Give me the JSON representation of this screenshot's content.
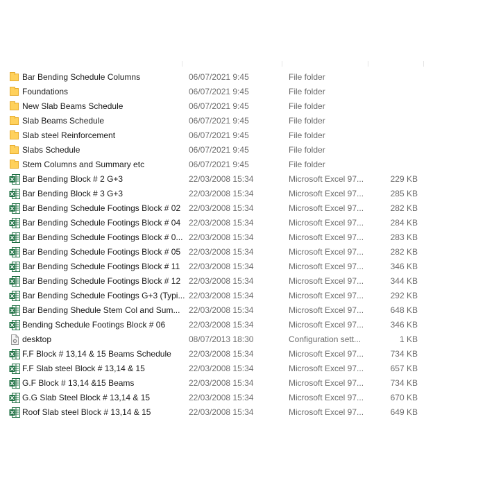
{
  "files": [
    {
      "name": "Bar Bending Schedule Columns",
      "date": "06/07/2021 9:45",
      "type": "File folder",
      "size": "",
      "icon": "folder-icon"
    },
    {
      "name": "Foundations",
      "date": "06/07/2021 9:45",
      "type": "File folder",
      "size": "",
      "icon": "folder-icon"
    },
    {
      "name": "New Slab Beams Schedule",
      "date": "06/07/2021 9:45",
      "type": "File folder",
      "size": "",
      "icon": "folder-icon"
    },
    {
      "name": "Slab Beams Schedule",
      "date": "06/07/2021 9:45",
      "type": "File folder",
      "size": "",
      "icon": "folder-icon"
    },
    {
      "name": "Slab steel Reinforcement",
      "date": "06/07/2021 9:45",
      "type": "File folder",
      "size": "",
      "icon": "folder-icon"
    },
    {
      "name": "Slabs Schedule",
      "date": "06/07/2021 9:45",
      "type": "File folder",
      "size": "",
      "icon": "folder-icon"
    },
    {
      "name": "Stem Columns and Summary etc",
      "date": "06/07/2021 9:45",
      "type": "File folder",
      "size": "",
      "icon": "folder-icon"
    },
    {
      "name": "Bar Bending Block # 2 G+3",
      "date": "22/03/2008 15:34",
      "type": "Microsoft Excel 97...",
      "size": "229 KB",
      "icon": "excel-file-icon"
    },
    {
      "name": "Bar Bending Block # 3 G+3",
      "date": "22/03/2008 15:34",
      "type": "Microsoft Excel 97...",
      "size": "285 KB",
      "icon": "excel-file-icon"
    },
    {
      "name": "Bar Bending Schedule Footings Block # 02",
      "date": "22/03/2008 15:34",
      "type": "Microsoft Excel 97...",
      "size": "282 KB",
      "icon": "excel-file-icon"
    },
    {
      "name": "Bar Bending Schedule Footings Block # 04",
      "date": "22/03/2008 15:34",
      "type": "Microsoft Excel 97...",
      "size": "284 KB",
      "icon": "excel-file-icon"
    },
    {
      "name": "Bar Bending Schedule Footings Block # 0...",
      "date": "22/03/2008 15:34",
      "type": "Microsoft Excel 97...",
      "size": "283 KB",
      "icon": "excel-file-icon"
    },
    {
      "name": "Bar Bending Schedule Footings Block # 05",
      "date": "22/03/2008 15:34",
      "type": "Microsoft Excel 97...",
      "size": "282 KB",
      "icon": "excel-file-icon"
    },
    {
      "name": "Bar Bending Schedule Footings Block # 11",
      "date": "22/03/2008 15:34",
      "type": "Microsoft Excel 97...",
      "size": "346 KB",
      "icon": "excel-file-icon"
    },
    {
      "name": "Bar Bending Schedule Footings Block # 12",
      "date": "22/03/2008 15:34",
      "type": "Microsoft Excel 97...",
      "size": "344 KB",
      "icon": "excel-file-icon"
    },
    {
      "name": "Bar Bending Schedule Footings G+3 (Typi...",
      "date": "22/03/2008 15:34",
      "type": "Microsoft Excel 97...",
      "size": "292 KB",
      "icon": "excel-file-icon"
    },
    {
      "name": "Bar Bending Shedule Stem Col and Sum...",
      "date": "22/03/2008 15:34",
      "type": "Microsoft Excel 97...",
      "size": "648 KB",
      "icon": "excel-file-icon"
    },
    {
      "name": "Bending Schedule Footings Block # 06",
      "date": "22/03/2008 15:34",
      "type": "Microsoft Excel 97...",
      "size": "346 KB",
      "icon": "excel-file-icon"
    },
    {
      "name": "desktop",
      "date": "08/07/2013 18:30",
      "type": "Configuration sett...",
      "size": "1 KB",
      "icon": "config-file-icon"
    },
    {
      "name": "F.F Block # 13,14 & 15 Beams Schedule",
      "date": "22/03/2008 15:34",
      "type": "Microsoft Excel 97...",
      "size": "734 KB",
      "icon": "excel-file-icon"
    },
    {
      "name": "F.F Slab steel Block # 13,14 & 15",
      "date": "22/03/2008 15:34",
      "type": "Microsoft Excel 97...",
      "size": "657 KB",
      "icon": "excel-file-icon"
    },
    {
      "name": "G.F Block # 13,14 &15 Beams",
      "date": "22/03/2008 15:34",
      "type": "Microsoft Excel 97...",
      "size": "734 KB",
      "icon": "excel-file-icon"
    },
    {
      "name": "G.G Slab Steel Block # 13,14 & 15",
      "date": "22/03/2008 15:34",
      "type": "Microsoft Excel 97...",
      "size": "670 KB",
      "icon": "excel-file-icon"
    },
    {
      "name": "Roof  Slab steel Block # 13,14 & 15",
      "date": "22/03/2008 15:34",
      "type": "Microsoft Excel 97...",
      "size": "649 KB",
      "icon": "excel-file-icon"
    }
  ],
  "colors": {
    "folder": "#ffd15c",
    "excel": "#1d6f42",
    "secondary_text": "#6d6d6d"
  }
}
